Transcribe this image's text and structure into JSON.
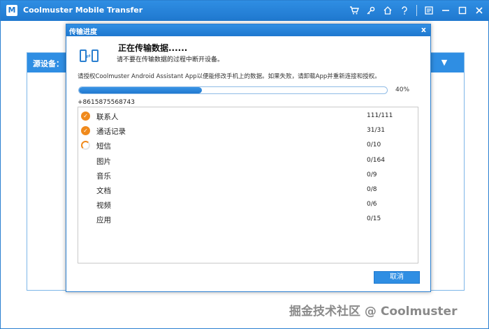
{
  "app": {
    "title": "Coolmuster Mobile Transfer",
    "logo_text": "M"
  },
  "titlebar_icons": [
    "cart-icon",
    "key-icon",
    "home-icon",
    "help-icon",
    "feedback-icon",
    "minimize-icon",
    "maximize-icon",
    "close-icon"
  ],
  "left_panel": {
    "header": "源设备："
  },
  "right_panel": {
    "header_icon": "▼"
  },
  "dialog": {
    "title": "传输进度",
    "close_label": "x",
    "heading": "正在传输数据......",
    "subheading": "请不要在传输数据的过程中断开设备。",
    "auth_note": "请授权Coolmuster Android Assistant App以便能修改手机上的数据。如果失败，请卸载App并重新连接和授权。",
    "progress_percent": 40,
    "progress_label": "40%",
    "phone_number": "+8615875568743",
    "items": [
      {
        "name": "联系人",
        "count": "111/111",
        "status": "done"
      },
      {
        "name": "通话记录",
        "count": "31/31",
        "status": "done"
      },
      {
        "name": "短信",
        "count": "0/10",
        "status": "loading"
      },
      {
        "name": "图片",
        "count": "0/164",
        "status": "pending"
      },
      {
        "name": "音乐",
        "count": "0/9",
        "status": "pending"
      },
      {
        "name": "文档",
        "count": "0/8",
        "status": "pending"
      },
      {
        "name": "视频",
        "count": "0/6",
        "status": "pending"
      },
      {
        "name": "应用",
        "count": "0/15",
        "status": "pending"
      }
    ],
    "cancel_label": "取消"
  },
  "watermark": "掘金技术社区 @ Coolmuster",
  "colors": {
    "accent": "#2f8ee3",
    "check": "#f08a1c"
  }
}
